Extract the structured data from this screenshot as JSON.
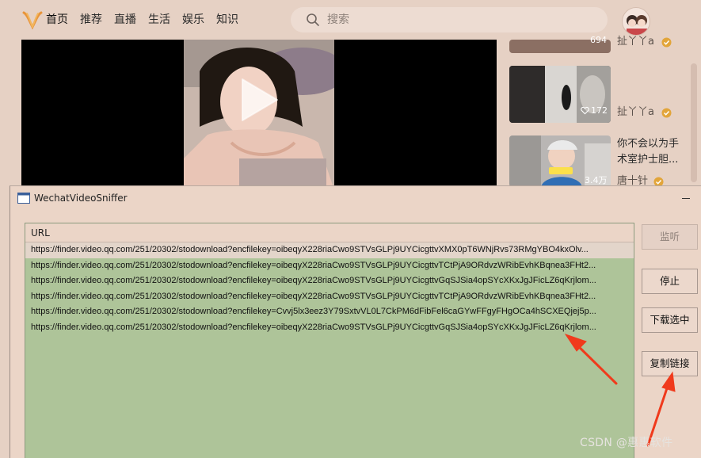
{
  "app": {
    "nav": [
      "首页",
      "推荐",
      "直播",
      "生活",
      "娱乐",
      "知识"
    ],
    "search_placeholder": "搜索"
  },
  "recommendations": [
    {
      "count": "694",
      "author": "扯丫丫a"
    },
    {
      "count": "172",
      "author": "扯丫丫a"
    },
    {
      "count": "3.4万",
      "author": "唐十针",
      "title_lines": [
        "你不会以为手",
        "术室护士胆..."
      ]
    }
  ],
  "sniffer": {
    "title": "WechatVideoSniffer",
    "list_header": "URL",
    "urls": [
      "https://finder.video.qq.com/251/20302/stodownload?encfilekey=oibeqyX228riaCwo9STVsGLPj9UYCicgttvXMX0pT6WNjRvs73RMgYBO4kxOlv...",
      "https://finder.video.qq.com/251/20302/stodownload?encfilekey=oibeqyX228riaCwo9STVsGLPj9UYCicgttvTCtPjA9ORdvzWRibEvhKBqnea3FHt2...",
      "https://finder.video.qq.com/251/20302/stodownload?encfilekey=oibeqyX228riaCwo9STVsGLPj9UYCicgttvGqSJSia4opSYcXKxJgJFicLZ6qKrjlom...",
      "https://finder.video.qq.com/251/20302/stodownload?encfilekey=oibeqyX228riaCwo9STVsGLPj9UYCicgttvTCtPjA9ORdvzWRibEvhKBqnea3FHt2...",
      "https://finder.video.qq.com/251/20302/stodownload?encfilekey=Cvvj5lx3eez3Y79SxtvVL0L7CkPM6dFibFel6caGYwFFgyFHgOCa4hSCXEQjej5p...",
      "https://finder.video.qq.com/251/20302/stodownload?encfilekey=oibeqyX228riaCwo9STVsGLPj9UYCicgttvGqSJSia4opSYcXKxJgJFicLZ6qKrjlom..."
    ],
    "buttons": {
      "listen": "监听",
      "stop": "停止",
      "download": "下载选中",
      "copy": "复制链接"
    }
  },
  "watermark": "CSDN @惠惠软件",
  "colors": {
    "background": "#e6d1c4",
    "list_background": "#aec499",
    "verified_badge": "#e2a53a",
    "arrow": "#f03a1c"
  }
}
